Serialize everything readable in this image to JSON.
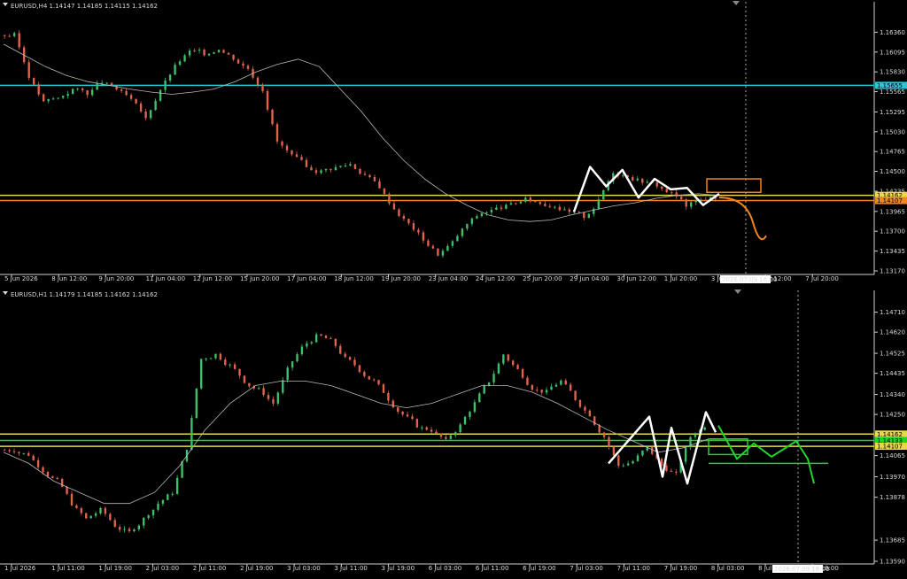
{
  "colors": {
    "background": "#000000",
    "axis": "#cfcfcf",
    "text": "#d9d9d9",
    "bull": "#3fbf6a",
    "bear": "#e0634d",
    "ma": "#b9b9b9",
    "cyan": "#24c9d6",
    "yellow": "#e8d84a",
    "orange": "#f0861e",
    "green": "#22d42a",
    "white": "#ffffff",
    "highlight": "#ffffff"
  },
  "chart_data": [
    {
      "type": "candlestick",
      "symbol_header": "EURUSD,H4  1.14147 1.14185 1.14115 1.14162",
      "ylim": [
        1.1317,
        1.16625
      ],
      "y_ticks": [
        "1.16360",
        "1.16095",
        "1.15830",
        "1.15565",
        "1.15295",
        "1.15030",
        "1.14765",
        "1.14500",
        "1.14235",
        "1.13965",
        "1.13700",
        "1.13435",
        "1.13170"
      ],
      "x_ticks": [
        "5 Jun 2026",
        "8 Jun 12:00",
        "9 Jun 20:00",
        "11 Jun 04:00",
        "12 Jun 12:00",
        "15 Jun 20:00",
        "17 Jun 04:00",
        "18 Jun 12:00",
        "19 Jun 20:00",
        "23 Jun 04:00",
        "24 Jun 12:00",
        "25 Jun 20:00",
        "29 Jun 04:00",
        "30 Jun 12:00",
        "1 Jul 20:00",
        "3 Jul 04:00",
        "6 Jul 12:00",
        "7 Jul 20:00"
      ],
      "time_label": "2026.07.09 16:00",
      "levels": [
        {
          "name": "cyan-level",
          "value": 1.1565,
          "color": "cyan",
          "label": "1.15655"
        },
        {
          "name": "yellow-level",
          "value": 1.1418,
          "color": "yellow",
          "label": "1.14162"
        },
        {
          "name": "orange-level",
          "value": 1.1411,
          "color": "orange",
          "label": "1.14107"
        }
      ],
      "price_series": [
        1.1632,
        1.1578,
        1.1542,
        1.1548,
        1.156,
        1.1555,
        1.157,
        1.156,
        1.1545,
        1.152,
        1.156,
        1.159,
        1.161,
        1.1608,
        1.1615,
        1.1602,
        1.1588,
        1.156,
        1.149,
        1.147,
        1.1455,
        1.145,
        1.1455,
        1.146,
        1.1445,
        1.143,
        1.14,
        1.138,
        1.136,
        1.134,
        1.1355,
        1.138,
        1.1395,
        1.14,
        1.1405,
        1.1412,
        1.1408,
        1.1405,
        1.1395,
        1.139,
        1.141,
        1.145,
        1.1445,
        1.1438,
        1.1432,
        1.142,
        1.1405,
        1.1412,
        1.1416
      ],
      "ma_series": [
        1.162,
        1.1605,
        1.159,
        1.1578,
        1.157,
        1.1565,
        1.156,
        1.1556,
        1.1553,
        1.1556,
        1.156,
        1.157,
        1.1583,
        1.1593,
        1.16,
        1.159,
        1.156,
        1.153,
        1.1495,
        1.1465,
        1.144,
        1.142,
        1.1405,
        1.1392,
        1.1385,
        1.1383,
        1.1385,
        1.1392,
        1.1398,
        1.1404,
        1.1408,
        1.1414,
        1.1418,
        1.142,
        1.1418
      ],
      "white_zigzag": [
        [
          1.1396
        ],
        [
          1.1456
        ],
        [
          1.143
        ],
        [
          1.1452
        ],
        [
          1.1415
        ],
        [
          1.144
        ],
        [
          1.1426
        ],
        [
          1.1428
        ],
        [
          1.1405
        ],
        [
          1.142
        ]
      ],
      "orange_projection": [
        1.1415,
        1.14,
        1.1382,
        1.1364
      ],
      "orange_box": [
        1.144,
        1.1422
      ]
    },
    {
      "type": "candlestick",
      "symbol_header": "EURUSD,H1  1.14179 1.14185 1.14162 1.14162",
      "ylim": [
        1.1359,
        1.1476
      ],
      "y_ticks": [
        "1.14710",
        "1.14620",
        "1.14525",
        "1.14435",
        "1.14340",
        "1.14250",
        "1.14155",
        "1.14065",
        "1.13970",
        "1.13878",
        "1.13685",
        "1.13590"
      ],
      "x_ticks": [
        "1 Jul 2026",
        "1 Jul 11:00",
        "1 Jul 19:00",
        "2 Jul 03:00",
        "2 Jul 11:00",
        "2 Jul 19:00",
        "3 Jul 03:00",
        "3 Jul 11:00",
        "3 Jul 19:00",
        "6 Jul 03:00",
        "6 Jul 11:00",
        "6 Jul 19:00",
        "7 Jul 03:00",
        "7 Jul 11:00",
        "7 Jul 19:00",
        "8 Jul 03:00",
        "8 Jul 11:00",
        "8 Jul 19:00"
      ],
      "time_label": "2026.07.09 16:00",
      "levels": [
        {
          "name": "yellow-level-top",
          "value": 1.14162,
          "color": "yellow",
          "label": "1.14162"
        },
        {
          "name": "green-level",
          "value": 1.14133,
          "color": "green",
          "label": "1.14133"
        },
        {
          "name": "yellow-level-bottom",
          "value": 1.14107,
          "color": "yellow",
          "label": "1.14107"
        }
      ],
      "price_series": [
        1.1409,
        1.1407,
        1.14,
        1.1395,
        1.1385,
        1.1378,
        1.1382,
        1.1375,
        1.1372,
        1.1378,
        1.1385,
        1.139,
        1.141,
        1.145,
        1.1452,
        1.1447,
        1.144,
        1.1436,
        1.143,
        1.1445,
        1.1455,
        1.146,
        1.1458,
        1.145,
        1.1445,
        1.144,
        1.1432,
        1.1425,
        1.142,
        1.1418,
        1.1413,
        1.142,
        1.143,
        1.144,
        1.1452,
        1.1445,
        1.1437,
        1.1435,
        1.144,
        1.1432,
        1.1425,
        1.1415,
        1.1402,
        1.1404,
        1.141,
        1.1402,
        1.1398,
        1.1415,
        1.142
      ],
      "ma_series": [
        1.1408,
        1.1403,
        1.1395,
        1.139,
        1.1385,
        1.1385,
        1.139,
        1.1402,
        1.1418,
        1.143,
        1.1438,
        1.144,
        1.144,
        1.1438,
        1.1434,
        1.143,
        1.1428,
        1.143,
        1.1434,
        1.1438,
        1.1438,
        1.1435,
        1.143,
        1.1424,
        1.1418,
        1.1413,
        1.1408,
        1.141,
        1.1414
      ],
      "white_zigzag": [
        1.1403,
        1.1424,
        1.1397,
        1.1419,
        1.1394,
        1.1426,
        1.1417
      ],
      "green_zigzag": [
        1.142,
        1.1405,
        1.1412,
        1.1406,
        1.1413,
        1.1405,
        1.1394
      ],
      "green_box": [
        1.1414,
        1.1407
      ],
      "green_rail": 1.1403
    }
  ]
}
